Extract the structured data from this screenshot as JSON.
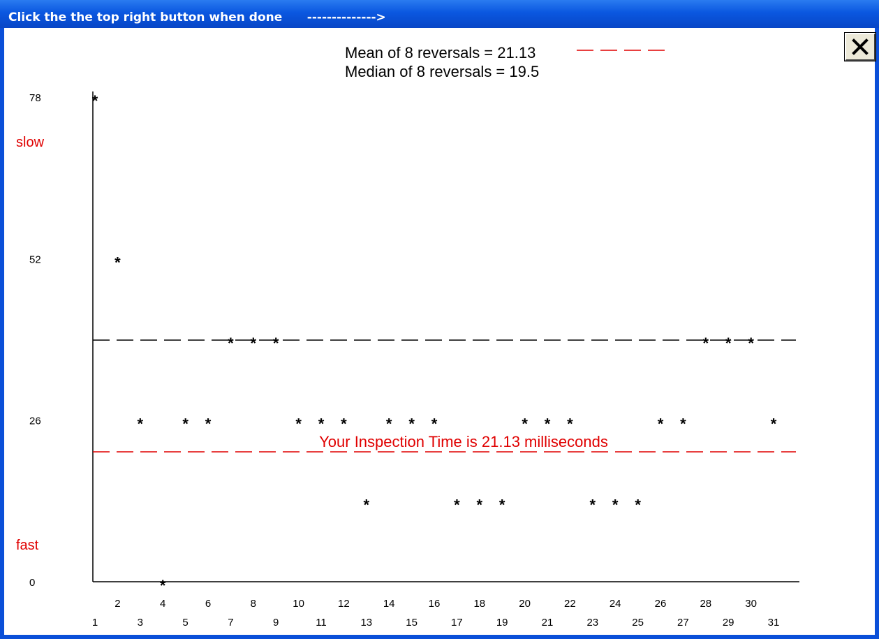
{
  "window": {
    "title": "Click the the top right button when done      -------------->",
    "close_icon": "close-x-icon"
  },
  "colors": {
    "titlebar": "#0a57e0",
    "accent_red": "#e00000",
    "ink": "#000000"
  },
  "chart_data": {
    "type": "scatter",
    "marker": "*",
    "y_ticks": [
      "78",
      "52",
      "26",
      "0"
    ],
    "y_tick_values": [
      78,
      52,
      26,
      0
    ],
    "ylim": [
      0,
      78
    ],
    "xlim": [
      0,
      31
    ],
    "x_ticks_row1": [
      "2",
      "4",
      "6",
      "8",
      "10",
      "12",
      "14",
      "16",
      "18",
      "20",
      "22",
      "24",
      "26",
      "28",
      "30"
    ],
    "x_ticks_row2": [
      "1",
      "3",
      "5",
      "7",
      "9",
      "11",
      "13",
      "15",
      "17",
      "19",
      "21",
      "23",
      "25",
      "27",
      "29",
      "31"
    ],
    "y_labels": {
      "top": "slow",
      "bottom": "fast"
    },
    "legend": {
      "mean": "Mean of 8 reversals = 21.13",
      "median": "Median of 8 reversals = 19.5"
    },
    "mean_line": 21.13,
    "median_line": 39,
    "annotation": "Your Inspection Time is  21.13  milliseconds",
    "series": [
      {
        "x": [
          1,
          2,
          3,
          4,
          5,
          6,
          7,
          8,
          9,
          10,
          11,
          12,
          13,
          14,
          15,
          16,
          17,
          18,
          19,
          20,
          21,
          22,
          23,
          24,
          25,
          26,
          27,
          28,
          29,
          30,
          31
        ],
        "y": [
          78,
          52,
          26,
          0,
          26,
          26,
          39,
          39,
          39,
          26,
          26,
          26,
          13,
          26,
          26,
          26,
          13,
          13,
          13,
          26,
          26,
          26,
          13,
          13,
          13,
          26,
          26,
          39,
          39,
          39,
          26
        ]
      }
    ]
  }
}
